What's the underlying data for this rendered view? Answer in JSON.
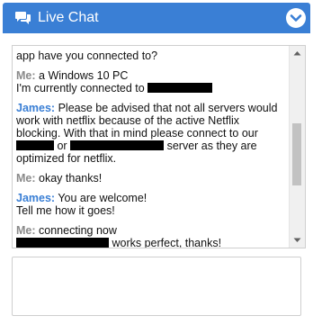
{
  "header": {
    "title": "Live Chat",
    "icon": "chat-bubbles-icon",
    "toggle_icon": "chevron-down-icon",
    "color": "#3a7fd5"
  },
  "transcript": {
    "first_line": "app have you connected to?",
    "messages": [
      {
        "speaker": "Me:",
        "lines": [
          "a Windows 10 PC",
          "I'm currently connected to"
        ]
      },
      {
        "speaker": "James:",
        "text_a": "Please be advised that not all servers would work with netflix because of the active Netflix blocking. With that in mind please connect to our",
        "text_b": "or",
        "text_c": "server as they are optimized for netflix."
      },
      {
        "speaker": "Me:",
        "text": "okay thanks!"
      },
      {
        "speaker": "James:",
        "text": "You are welcome!",
        "text2": "Tell me how it goes!"
      },
      {
        "speaker": "Me:",
        "text": "connecting now",
        "text2": "works perfect, thanks!"
      }
    ]
  },
  "input": {
    "placeholder": ""
  }
}
